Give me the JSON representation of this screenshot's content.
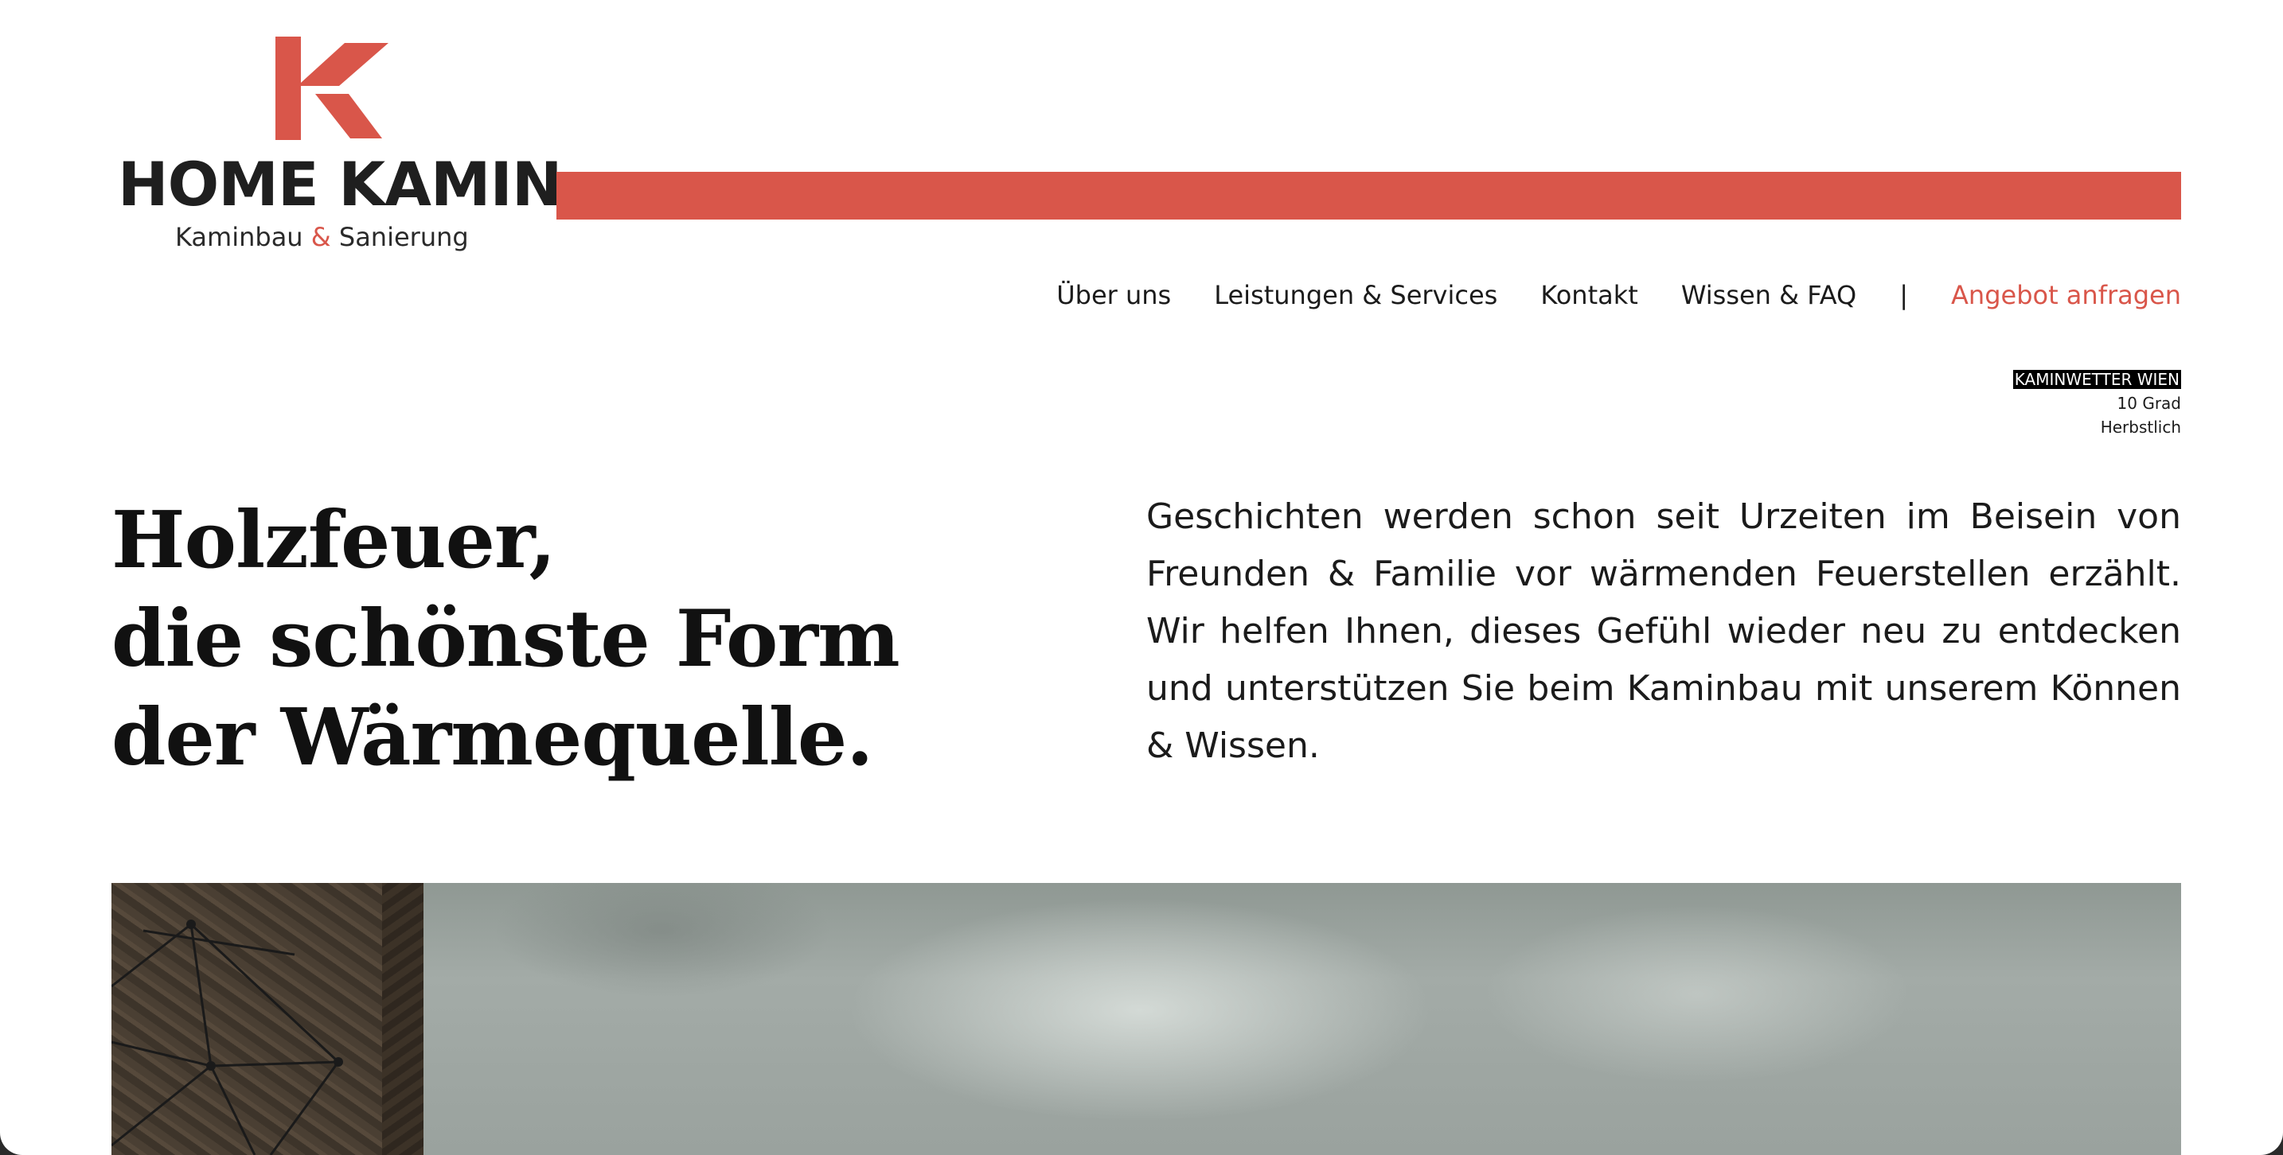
{
  "brand": {
    "name": "HOME KAMIN",
    "tagline_part1": "Kaminbau",
    "tagline_amp": "&",
    "tagline_part2": "Sanierung",
    "accent_color": "#d9564a"
  },
  "nav": {
    "items": [
      {
        "label": "Über uns"
      },
      {
        "label": "Leistungen & Services"
      },
      {
        "label": "Kontakt"
      },
      {
        "label": "Wissen & FAQ"
      }
    ],
    "separator": "|",
    "cta_label": "Angebot anfragen"
  },
  "weather": {
    "title": "KAMINWETTER WIEN",
    "temperature": "10 Grad",
    "condition": "Herbstlich"
  },
  "hero": {
    "headline_lines": [
      "Holzfeuer,",
      "die schönste Form",
      "der Wärmequelle."
    ],
    "intro": "Geschichten werden schon seit Urzeiten im Beisein von Freunden & Familie vor wärmenden Feuerstellen erzählt. Wir helfen Ihnen, dieses Gefühl wieder neu zu entdecken und unterstützen Sie beim Kaminbau mit unserem Können & Wissen."
  }
}
